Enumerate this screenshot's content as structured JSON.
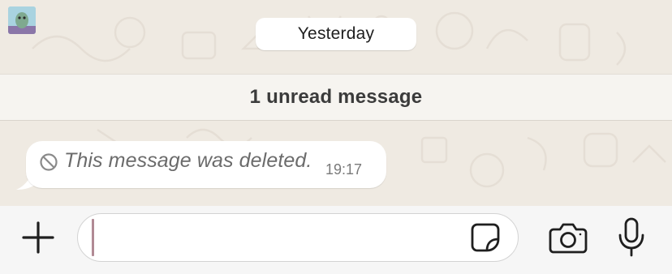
{
  "chat": {
    "date_divider": "Yesterday",
    "unread_banner": "1 unread message",
    "messages": [
      {
        "text": "This message was deleted.",
        "time": "19:17",
        "status_icon": "deleted-icon"
      }
    ]
  },
  "composer": {
    "input_value": "",
    "icons": {
      "attach": "plus-icon",
      "sticker": "sticker-icon",
      "camera": "camera-icon",
      "voice": "microphone-icon"
    }
  },
  "colors": {
    "chat_background": "#efeae2",
    "bubble": "#ffffff",
    "input_bar": "#f6f6f6",
    "caret": "#b18a94",
    "icon": "#1f1f1f"
  }
}
